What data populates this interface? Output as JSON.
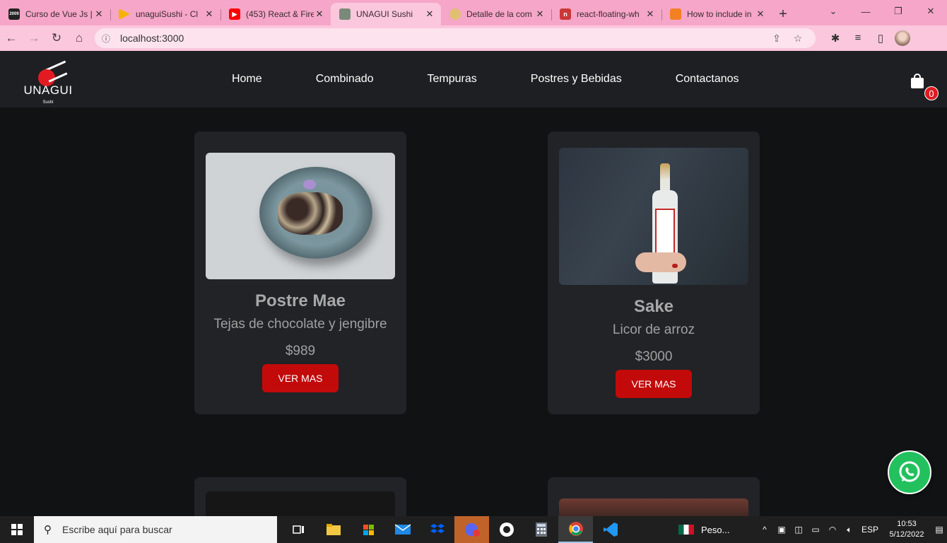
{
  "browser": {
    "tabs": [
      {
        "title": "Curso de Vue Js |",
        "favicon_color": "#222222",
        "favicon_text": "2009"
      },
      {
        "title": "unaguiSushi - Cl",
        "favicon_color": "#f4b400",
        "favicon_text": ""
      },
      {
        "title": "(453) React & Fire",
        "favicon_color": "#ff0000",
        "favicon_text": "▶"
      },
      {
        "title": "UNAGUI Sushi",
        "favicon_color": "#7a8a7a",
        "favicon_text": "",
        "active": true
      },
      {
        "title": "Detalle de la com",
        "favicon_color": "#e0c070",
        "favicon_text": ""
      },
      {
        "title": "react-floating-wh",
        "favicon_color": "#cb3837",
        "favicon_text": "n"
      },
      {
        "title": "How to include in",
        "favicon_color": "#f48024",
        "favicon_text": ""
      }
    ],
    "close_glyph": "✕",
    "new_tab_glyph": "+",
    "window_controls": [
      "⌄",
      "—",
      "❐",
      "✕"
    ],
    "url": "localhost:3000",
    "accent": "#f6a6c8"
  },
  "site": {
    "logo": {
      "name": "UNAGUI",
      "sub": "Sushi"
    },
    "nav": [
      "Home",
      "Combinado",
      "Tempuras",
      "Postres y Bebidas",
      "Contactanos"
    ],
    "cart_count": "0",
    "brand_red": "#e21b23"
  },
  "products": [
    {
      "name": "Postre Mae",
      "desc": "Tejas de chocolate y jengibre",
      "price": "$989",
      "button": "VER MAS"
    },
    {
      "name": "Sake",
      "desc": "Licor de arroz",
      "price": "$3000",
      "button": "VER MAS"
    }
  ],
  "taskbar": {
    "search_placeholder": "Escribe aquí para buscar",
    "weather": "Peso...",
    "lang": "ESP",
    "time": "10:53",
    "date": "5/12/2022"
  }
}
